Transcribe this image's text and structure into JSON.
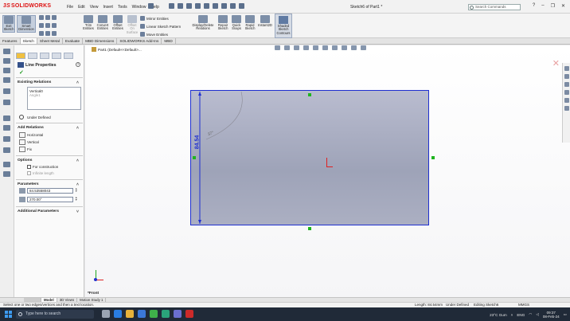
{
  "app": {
    "logo_ds": "3S",
    "logo_name": "SOLIDWORKS",
    "menu": [
      "File",
      "Edit",
      "View",
      "Insert",
      "Tools",
      "Window",
      "Help"
    ],
    "doc_title": "Sketch6 of Part1 *",
    "search_placeholder": "Search Commands",
    "window_buttons": [
      "?",
      "–",
      "❐",
      "✕"
    ]
  },
  "ribbon": {
    "exit_sketch": "Exit Sketch",
    "smart_dimension": "Smart Dimension",
    "trim_entities": "Trim Entities",
    "convert_entities": "Convert Entities",
    "offset_entities": "Offset Entities",
    "offset_on_surface": "Offset On Surface",
    "mirror_entities": "Mirror Entities",
    "linear_sketch_pattern": "Linear Sketch Pattern",
    "move_entities": "Move Entities",
    "display_delete_relations": "Display/Delete Relations",
    "repair_sketch": "Repair Sketch",
    "quick_snaps": "Quick Snaps",
    "rapid_sketch": "Rapid Sketch",
    "instant2d": "Instant2D",
    "shaded_sketch_contours": "Shaded Sketch Contours"
  },
  "cm_tabs": [
    "Features",
    "Sketch",
    "Sheet Metal",
    "Evaluate",
    "MBD Dimensions",
    "SOLIDWORKS Add-Ins",
    "MBD"
  ],
  "cm_active_tab": 1,
  "property_manager": {
    "title": "Line Properties",
    "existing_relations_label": "Existing Relations",
    "existing_relations": [
      "Vertical0"
    ],
    "existing_relations_muted": "Angle1",
    "status": "Under Defined",
    "add_relations_label": "Add Relations",
    "add_relations": [
      "Horizontal",
      "Vertical",
      "Fix"
    ],
    "options_label": "Options",
    "for_construction": "For construction",
    "infinite_length": "Infinite length",
    "parameters_label": "Parameters",
    "length_value": "84.53558043",
    "angle_value": "270.00°",
    "additional_params_label": "Additional Parameters"
  },
  "viewport": {
    "tree_label": "Part1  (Default<<Default>...",
    "dimension": "84.54",
    "angle_dim": "37°",
    "view_label": "*Front"
  },
  "model_tabs": [
    "",
    "Model",
    "3D Views",
    "Motion Study 1"
  ],
  "model_active_tab": 1,
  "status_bar": {
    "message": "Select one or two edges/vertices and then a text location.",
    "length": "Length: 84.54mm",
    "defined": "Under Defined",
    "editing": "Editing Sketch6",
    "units": "MMGS"
  },
  "taskbar": {
    "search_placeholder": "Type here to search",
    "weather": "23°C  Gum",
    "lang": "ENG",
    "time": "09:37",
    "date": "08-Feb-24"
  },
  "colors": {
    "sketch_blue": "#1e2fd0",
    "node_green": "#1fb41f",
    "origin_red": "#e02020",
    "taskbar": "#202a38"
  }
}
